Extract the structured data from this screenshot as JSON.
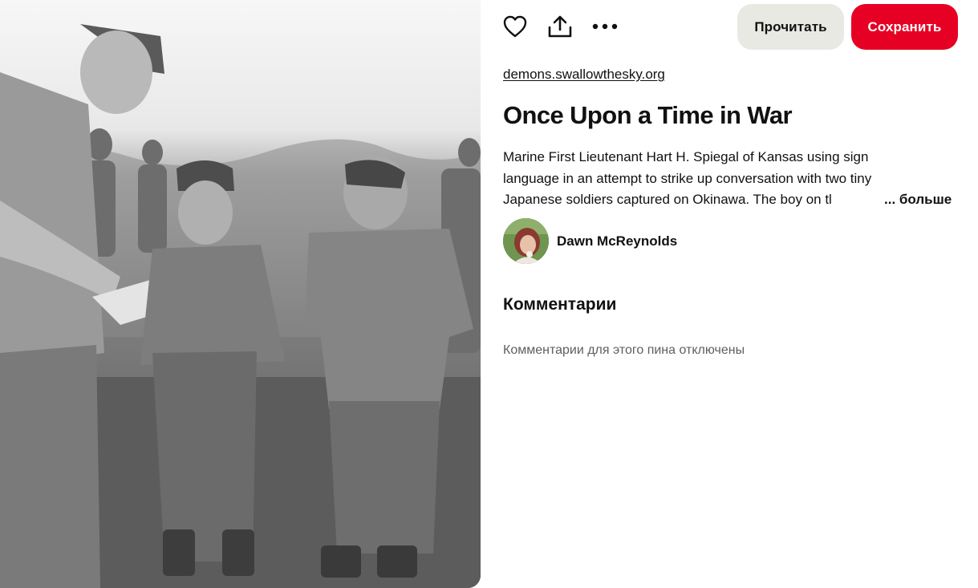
{
  "photo": {
    "icon": "archival-photo"
  },
  "actions": {
    "like_icon": "heart-icon",
    "share_icon": "share-icon",
    "more_icon": "more-icon",
    "read_label": "Прочитать",
    "save_label": "Сохранить"
  },
  "pin": {
    "source": "demons.swallowthesky.org",
    "title": "Once Upon a Time in War",
    "description_lines": [
      "Marine First Lieutenant Hart H. Spiegal of Kansas using sign",
      "language in an attempt to strike up conversation with two tiny",
      "Japanese soldiers captured on Okinawa. The boy on tl"
    ],
    "more_label": "... больше"
  },
  "author": {
    "name": "Dawn McReynolds"
  },
  "comments": {
    "heading": "Комментарии",
    "disabled_text": "Комментарии для этого пина отключены"
  },
  "colors": {
    "save": "#e60023",
    "read": "#e9e9e4",
    "muted": "#5f5f5f"
  }
}
